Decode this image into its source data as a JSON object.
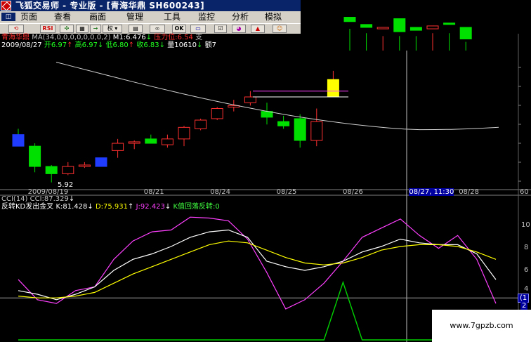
{
  "window": {
    "title": "飞狐交易师 - 专业版 - [青海华鼎 SH600243]"
  },
  "menu": {
    "system_icon": "◫",
    "items": [
      "页面",
      "查看",
      "画面",
      "管理",
      "工具",
      "监控",
      "分析",
      "模拟"
    ]
  },
  "toolbar": {
    "buttons": [
      {
        "icon": "refresh-icon",
        "label": "⟲"
      },
      {
        "icon": "rsi-icon",
        "label": "RSI"
      },
      {
        "icon": "arrows-icon",
        "label": "✣"
      },
      {
        "icon": "grid-icon",
        "label": "▦"
      },
      {
        "icon": "arrow-right-icon",
        "label": "→"
      },
      {
        "icon": "weight-icon",
        "label": "权 ▾"
      },
      {
        "icon": "chart-icon",
        "label": "▤"
      },
      {
        "icon": "glasses-icon",
        "label": "∞"
      },
      {
        "icon": "ok-icon",
        "label": "OK"
      },
      {
        "icon": "monitor-icon",
        "label": "▭"
      },
      {
        "icon": "checkbox-icon",
        "label": "☑"
      },
      {
        "icon": "palette-icon",
        "label": "◕"
      },
      {
        "icon": "bell-icon",
        "label": "▲"
      },
      {
        "icon": "user-icon",
        "label": "☺"
      }
    ]
  },
  "main_info": {
    "stock_name": "青海华鼎",
    "ma_label": "MA(34,0,0,0,0,0,0,0,2)",
    "m1": "M1:6.476",
    "pressure": "压力位:6.54",
    "trailing": "支",
    "date": "2009/08/27",
    "open": "开6.97",
    "high": "高6.97",
    "low": "低6.80",
    "close": "收6.83",
    "volume": "量10610",
    "amount": "额7"
  },
  "candles": [
    {
      "open": 6.12,
      "close": 6.04,
      "high": 6.16,
      "low": 6.04
    },
    {
      "open": 6.04,
      "close": 5.9,
      "high": 6.06,
      "low": 5.86
    },
    {
      "open": 5.9,
      "close": 5.85,
      "high": 5.91,
      "low": 5.79
    },
    {
      "open": 5.85,
      "close": 5.9,
      "high": 5.93,
      "low": 5.84
    },
    {
      "open": 5.9,
      "close": 5.91,
      "high": 5.93,
      "low": 5.89
    },
    {
      "open": 5.9,
      "close": 5.96,
      "high": 5.96,
      "low": 5.9
    },
    {
      "open": 6.01,
      "close": 6.06,
      "high": 6.09,
      "low": 5.96
    },
    {
      "open": 6.06,
      "close": 6.07,
      "high": 6.08,
      "low": 6.02
    },
    {
      "open": 6.09,
      "close": 6.06,
      "high": 6.12,
      "low": 6.06
    },
    {
      "open": 6.05,
      "close": 6.09,
      "high": 6.12,
      "low": 6.03
    },
    {
      "open": 6.09,
      "close": 6.17,
      "high": 6.18,
      "low": 6.04
    },
    {
      "open": 6.16,
      "close": 6.22,
      "high": 6.23,
      "low": 6.15
    },
    {
      "open": 6.23,
      "close": 6.3,
      "high": 6.31,
      "low": 6.22
    },
    {
      "open": 6.31,
      "close": 6.32,
      "high": 6.36,
      "low": 6.28
    },
    {
      "open": 6.34,
      "close": 6.38,
      "high": 6.42,
      "low": 6.32
    },
    {
      "open": 6.28,
      "close": 6.24,
      "high": 6.34,
      "low": 6.19
    },
    {
      "open": 6.21,
      "close": 6.18,
      "high": 6.25,
      "low": 6.16
    },
    {
      "open": 6.23,
      "close": 6.08,
      "high": 6.26,
      "low": 6.03
    },
    {
      "open": 6.08,
      "close": 6.21,
      "high": 6.3,
      "low": 6.04
    },
    {
      "open": 6.38,
      "close": 6.5,
      "high": 6.56,
      "low": 6.38
    },
    {
      "open": 6.93,
      "close": 6.9,
      "high": 6.97,
      "low": 6.85
    },
    {
      "open": 6.88,
      "close": 6.86,
      "high": 6.97,
      "low": 6.82
    },
    {
      "open": 6.85,
      "close": 6.86,
      "high": 6.92,
      "low": 6.8
    },
    {
      "open": 6.92,
      "close": 6.83,
      "high": 6.97,
      "low": 6.8
    },
    {
      "open": 6.86,
      "close": 6.84,
      "high": 6.97,
      "low": 6.8
    },
    {
      "open": 6.85,
      "close": 6.87,
      "high": 6.97,
      "low": 6.82
    },
    {
      "open": 6.89,
      "close": 6.88,
      "high": 6.97,
      "low": 6.82
    },
    {
      "open": 6.86,
      "close": 6.78,
      "high": 6.88,
      "low": 6.76
    }
  ],
  "price_axis": {
    "low_mark": "5.92"
  },
  "date_labels": [
    {
      "label": "2009/08/19",
      "index": 1
    },
    {
      "label": "08/21",
      "index": 8
    },
    {
      "label": "08/24",
      "index": 12
    },
    {
      "label": "08/25",
      "index": 16
    },
    {
      "label": "08/26",
      "index": 20
    },
    {
      "label": "08/27, 11:30",
      "index": 24
    },
    {
      "label": "08/28",
      "index": 27
    }
  ],
  "right_axis_top": "60",
  "indicator": {
    "cci_label": "CCI(14) CCI:87.329",
    "line2_name": "反转KD发出金叉",
    "k": "K:81.428",
    "d": "D:75.931",
    "j": "J:92.423",
    "signal": "K值回落反转:0",
    "right_ticks": [
      "10",
      "8",
      "6",
      "4",
      "2"
    ],
    "right_box": "(1",
    "right_box2": "2"
  },
  "kd_series": {
    "J": [
      40,
      18,
      14,
      28,
      32,
      62,
      82,
      92,
      94,
      108,
      107,
      104,
      84,
      48,
      8,
      18,
      36,
      60,
      86,
      96,
      106,
      88,
      74,
      88,
      62,
      14
    ],
    "K": [
      28,
      24,
      18,
      24,
      32,
      50,
      62,
      68,
      76,
      86,
      92,
      94,
      86,
      60,
      54,
      50,
      54,
      60,
      70,
      76,
      84,
      80,
      78,
      78,
      68,
      40
    ],
    "D": [
      22,
      20,
      20,
      22,
      26,
      36,
      46,
      54,
      62,
      70,
      78,
      82,
      80,
      72,
      64,
      58,
      56,
      58,
      64,
      72,
      76,
      78,
      78,
      76,
      70,
      62
    ]
  },
  "signal_series": [
    0,
    0,
    0,
    0,
    0,
    0,
    0,
    0,
    0,
    0,
    0,
    0,
    0,
    0,
    0,
    0,
    0,
    1,
    0,
    0,
    0,
    0,
    0,
    0,
    0,
    0
  ],
  "cursor_label": "08/27, 11:30",
  "watermark": "www.7gpzb.com",
  "colors": {
    "up": "#ff3030",
    "down": "#00e000",
    "ma": "#d0d0d0",
    "k": "#ffffff",
    "d": "#ffff00",
    "j": "#ff40ff",
    "signal": "#00d000",
    "grid": "#303030"
  }
}
